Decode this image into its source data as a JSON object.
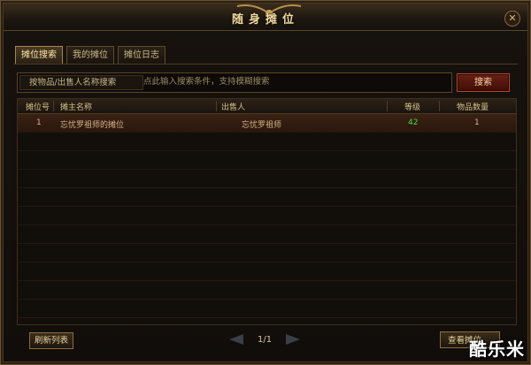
{
  "window": {
    "title": "随身摊位",
    "close_symbol": "✕"
  },
  "tabs": [
    {
      "label": "摊位搜索",
      "active": true
    },
    {
      "label": "我的摊位",
      "active": false
    },
    {
      "label": "摊位日志",
      "active": false
    }
  ],
  "search": {
    "filter_label": "按物品/出售人名称搜索",
    "placeholder": "点此输入搜索条件，支持模糊搜索",
    "button_label": "搜索"
  },
  "table": {
    "headers": [
      "摊位号",
      "摊主名称",
      "出售人",
      "等级",
      "物品数量"
    ],
    "rows": [
      {
        "stall_no": "1",
        "stall_name": "忘忧罗祖师的摊位",
        "seller": "忘忧罗祖师",
        "level": "42",
        "item_count": "1"
      }
    ]
  },
  "footer": {
    "refresh_label": "刷新列表",
    "page_indicator": "1/1",
    "view_label": "查看摊位"
  },
  "watermark": "酷乐米",
  "colors": {
    "level_green": "#4cd64c",
    "search_red": "#6c1f14",
    "frame_gold": "#a58450"
  }
}
